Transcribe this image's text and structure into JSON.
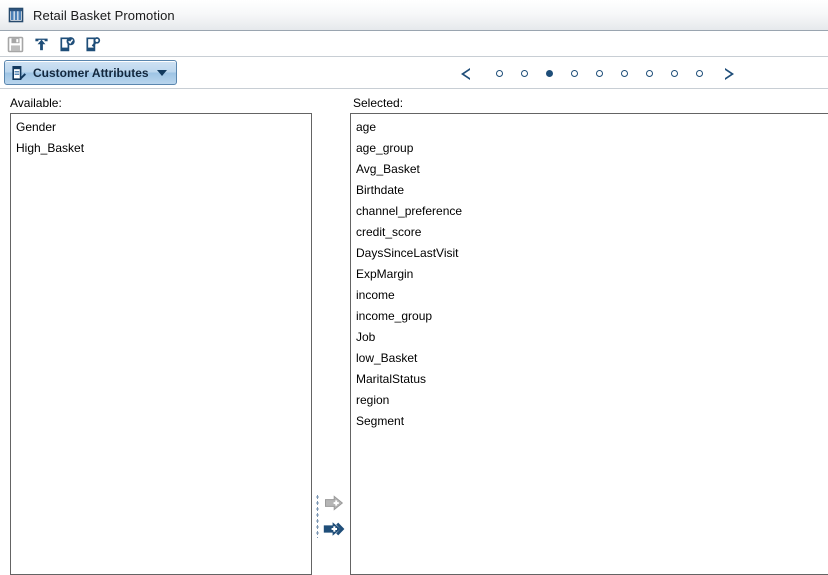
{
  "window": {
    "title": "Retail Basket Promotion",
    "icon": "table-grid-icon"
  },
  "toolbar": {
    "buttons": [
      {
        "name": "save-button",
        "icon": "floppy-disk-icon",
        "label": "Save",
        "enabled": false
      },
      {
        "name": "export-button",
        "icon": "upload-arrow-icon",
        "label": "Export",
        "enabled": true
      },
      {
        "name": "validate-button",
        "icon": "document-check-icon",
        "label": "Validate",
        "enabled": true
      },
      {
        "name": "run-button",
        "icon": "document-wrench-icon",
        "label": "Run",
        "enabled": true
      }
    ]
  },
  "tab": {
    "label": "Customer Attributes",
    "icon": "document-edit-icon",
    "caret": "chevron-down-icon"
  },
  "pager": {
    "prev_label": "Previous",
    "next_label": "Next",
    "total_steps": 9,
    "active_step": 3
  },
  "panels": {
    "available": {
      "label": "Available:",
      "items": [
        "Gender",
        "High_Basket"
      ]
    },
    "selected": {
      "label": "Selected:",
      "items": [
        "age",
        "age_group",
        "Avg_Basket",
        "Birthdate",
        "channel_preference",
        "credit_score",
        "DaysSinceLastVisit",
        "ExpMargin",
        "income",
        "income_group",
        "Job",
        "low_Basket",
        "MaritalStatus",
        "region",
        "Segment"
      ]
    }
  },
  "transfer": {
    "move_one_label": "Add selected",
    "move_all_label": "Add all",
    "move_one_enabled": false,
    "move_all_enabled": true
  },
  "colors": {
    "accent": "#1f4e79",
    "disabled": "#a6a6a6",
    "tab_border": "#5a86ae",
    "list_border": "#646464"
  }
}
